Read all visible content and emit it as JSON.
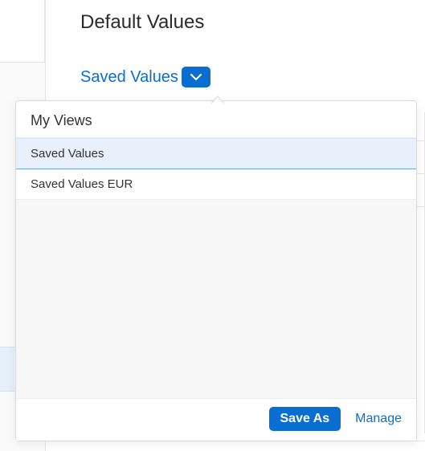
{
  "page": {
    "title": "Default Values"
  },
  "dropdown": {
    "selected_label": "Saved Values"
  },
  "popover": {
    "header": "My Views",
    "items": [
      {
        "label": "Saved Values",
        "selected": true
      },
      {
        "label": "Saved Values EUR",
        "selected": false
      }
    ],
    "footer": {
      "save_as_label": "Save As",
      "manage_label": "Manage"
    }
  },
  "icons": {
    "chevron_down": "chevron-down-icon"
  },
  "colors": {
    "accent": "#0a6ed1",
    "selected_bg": "#e8f1fb"
  }
}
